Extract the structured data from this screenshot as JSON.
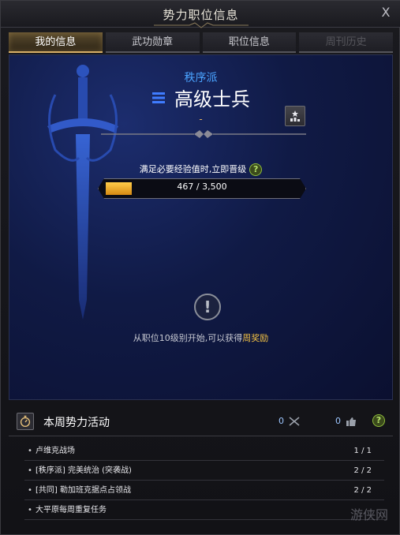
{
  "window": {
    "title": "势力职位信息",
    "close_label": "X"
  },
  "tabs": [
    {
      "label": "我的信息",
      "state": "active"
    },
    {
      "label": "武功勋章",
      "state": "normal"
    },
    {
      "label": "职位信息",
      "state": "normal"
    },
    {
      "label": "周刊历史",
      "state": "disabled"
    }
  ],
  "rank": {
    "faction": "秩序派",
    "title": "高级士兵",
    "sub": "-"
  },
  "xp": {
    "hint": "满足必要经验值时,立即晋级",
    "current": 467,
    "max": 3500,
    "text": "467 / 3,500",
    "help": "?"
  },
  "notice": {
    "icon": "!",
    "prefix": "从职位10级别开始,可以获得",
    "highlight": "周奖励"
  },
  "weekly": {
    "title": "本周势力活动",
    "counter_a": "0",
    "counter_b": "0",
    "help": "?",
    "items": [
      {
        "bullet": "•",
        "label": "卢维克战场",
        "value": "1 / 1"
      },
      {
        "bullet": "•",
        "label": "[秩序派] 完美统治 (突袭战)",
        "value": "2 / 2"
      },
      {
        "bullet": "•",
        "label": "[共同] 勒加班克据点占领战",
        "value": "2 / 2"
      },
      {
        "bullet": "•",
        "label": "大平原每周重复任务",
        "value": ""
      }
    ]
  },
  "watermark": "游侠网",
  "colors": {
    "accent_blue": "#4aa3ff",
    "gold": "#f3c244",
    "xp_fill": "#e6a020"
  }
}
